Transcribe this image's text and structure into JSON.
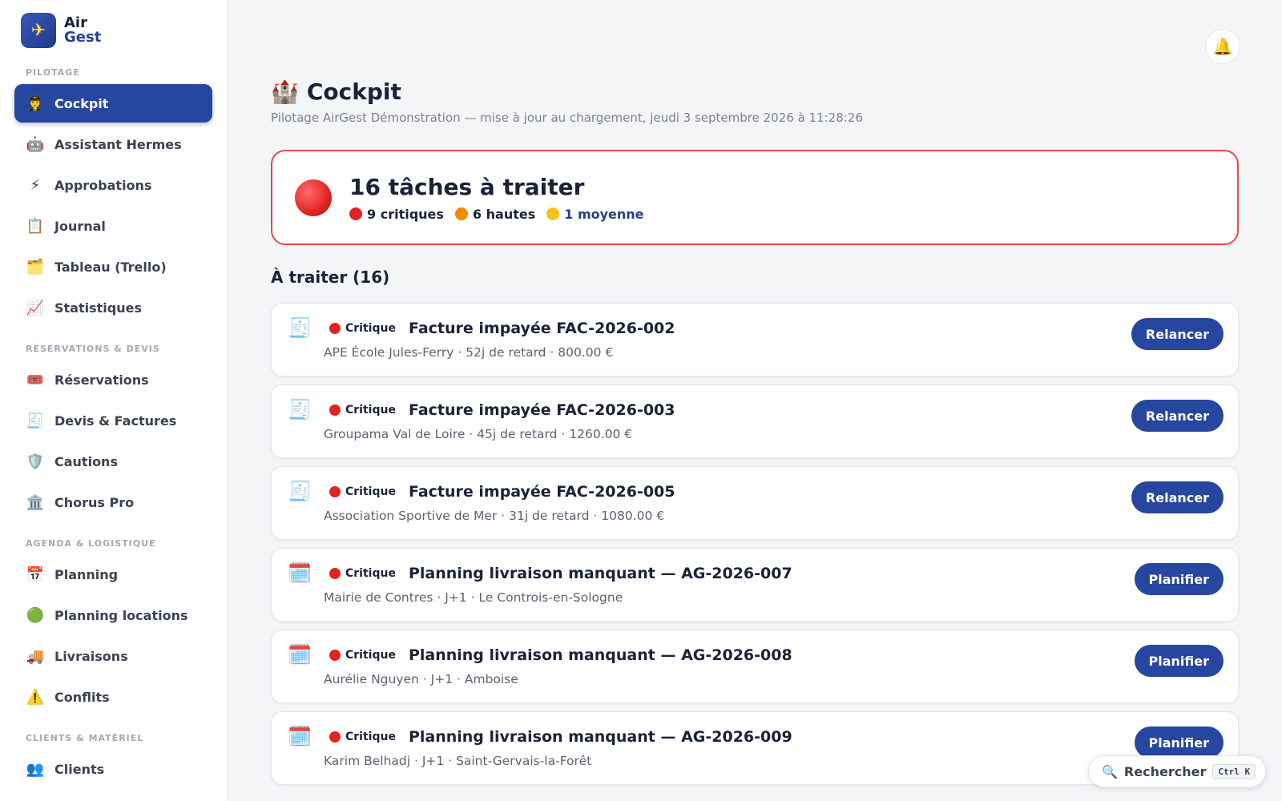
{
  "brand": {
    "line1": "Air",
    "line2": "Gest",
    "logo_icon": "✈"
  },
  "sidebar": {
    "sections": [
      {
        "label": "PILOTAGE",
        "items": [
          {
            "icon": "🧑‍✈️",
            "icon_name": "pilot-icon",
            "label": "Cockpit",
            "active": true
          },
          {
            "icon": "🤖",
            "icon_name": "robot-icon",
            "label": "Assistant Hermes"
          },
          {
            "icon": "⚡",
            "icon_name": "lightning-icon",
            "label": "Approbations"
          },
          {
            "icon": "📋",
            "icon_name": "clipboard-icon",
            "label": "Journal"
          },
          {
            "icon": "🗂️",
            "icon_name": "card-index-icon",
            "label": "Tableau (Trello)"
          },
          {
            "icon": "📈",
            "icon_name": "chart-up-icon",
            "label": "Statistiques"
          }
        ]
      },
      {
        "label": "RÉSERVATIONS & DEVIS",
        "items": [
          {
            "icon": "🎟️",
            "icon_name": "ticket-icon",
            "label": "Réservations"
          },
          {
            "icon": "🧾",
            "icon_name": "receipt-icon",
            "label": "Devis & Factures"
          },
          {
            "icon": "🛡️",
            "icon_name": "shield-icon",
            "label": "Cautions"
          },
          {
            "icon": "🏛️",
            "icon_name": "bank-icon",
            "label": "Chorus Pro"
          }
        ]
      },
      {
        "label": "AGENDA & LOGISTIQUE",
        "items": [
          {
            "icon": "📅",
            "icon_name": "calendar-icon",
            "label": "Planning"
          },
          {
            "icon": "🟢",
            "icon_name": "green-circle-icon",
            "label": "Planning locations"
          },
          {
            "icon": "🚚",
            "icon_name": "truck-icon",
            "label": "Livraisons"
          },
          {
            "icon": "⚠️",
            "icon_name": "warning-icon",
            "label": "Conflits"
          }
        ]
      },
      {
        "label": "CLIENTS & MATÉRIEL",
        "items": [
          {
            "icon": "👥",
            "icon_name": "users-icon",
            "label": "Clients"
          }
        ]
      }
    ]
  },
  "header": {
    "title_icon": "🏰",
    "title": "Cockpit",
    "subtitle": "Pilotage AirGest Démonstration — mise à jour au chargement, jeudi 3 septembre 2026 à 11:28:26",
    "bell_icon": "🔔"
  },
  "alert": {
    "title": "16 tâches à traiter",
    "critical": "9 critiques",
    "high": "6 hautes",
    "medium": "1 moyenne"
  },
  "list": {
    "title": "À traiter (16)",
    "tasks": [
      {
        "icon": "🧾",
        "icon_name": "receipt-icon",
        "badge": "Critique",
        "title": "Facture impayée FAC-2026-002",
        "sub": "APE École Jules-Ferry · 52j de retard · 800.00 €",
        "action": "Relancer"
      },
      {
        "icon": "🧾",
        "icon_name": "receipt-icon",
        "badge": "Critique",
        "title": "Facture impayée FAC-2026-003",
        "sub": "Groupama Val de Loire · 45j de retard · 1260.00 €",
        "action": "Relancer"
      },
      {
        "icon": "🧾",
        "icon_name": "receipt-icon",
        "badge": "Critique",
        "title": "Facture impayée FAC-2026-005",
        "sub": "Association Sportive de Mer · 31j de retard · 1080.00 €",
        "action": "Relancer"
      },
      {
        "icon": "🗓️",
        "icon_name": "calendar-icon",
        "badge": "Critique",
        "title": "Planning livraison manquant — AG-2026-007",
        "sub": "Mairie de Contres · J+1 · Le Controis-en-Sologne",
        "action": "Planifier"
      },
      {
        "icon": "🗓️",
        "icon_name": "calendar-icon",
        "badge": "Critique",
        "title": "Planning livraison manquant — AG-2026-008",
        "sub": "Aurélie Nguyen · J+1 · Amboise",
        "action": "Planifier"
      },
      {
        "icon": "🗓️",
        "icon_name": "calendar-icon",
        "badge": "Critique",
        "title": "Planning livraison manquant — AG-2026-009",
        "sub": "Karim Belhadj · J+1 · Saint-Gervais-la-Forêt",
        "action": "Planifier"
      }
    ]
  },
  "search": {
    "icon": "🔍",
    "label": "Rechercher",
    "shortcut": "Ctrl K"
  }
}
